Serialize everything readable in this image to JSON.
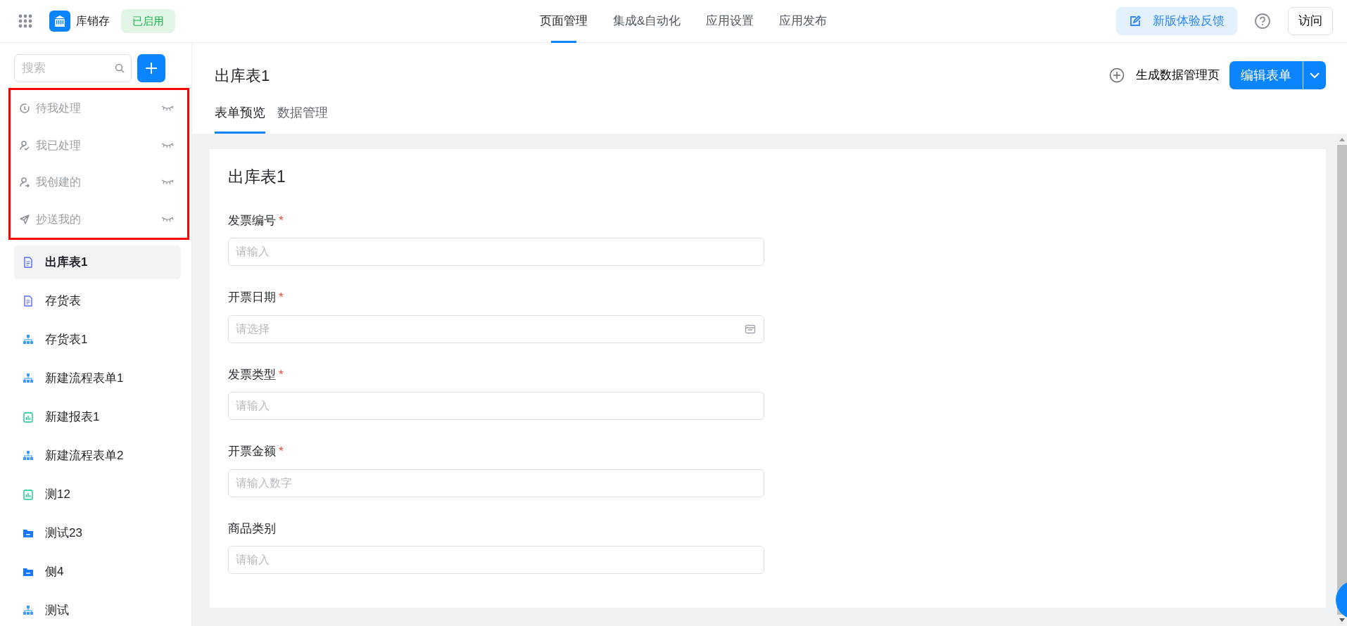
{
  "app_bar": {
    "app_name": "库销存",
    "status_badge": "已启用",
    "feedback_button": "新版体验反馈",
    "visit_button": "访问",
    "nav_tabs": [
      {
        "label": "页面管理",
        "selected": true
      },
      {
        "label": "集成&自动化",
        "selected": false
      },
      {
        "label": "应用设置",
        "selected": false
      },
      {
        "label": "应用发布",
        "selected": false
      }
    ]
  },
  "sidebar": {
    "search": {
      "placeholder": "搜索"
    },
    "system_views": {
      "highlighted": true,
      "items": [
        {
          "label": "待我处理",
          "kind": "pending",
          "hidden": true
        },
        {
          "label": "我已处理",
          "kind": "done",
          "hidden": true
        },
        {
          "label": "我创建的",
          "kind": "created",
          "hidden": true
        },
        {
          "label": "抄送我的",
          "kind": "cc",
          "hidden": true
        }
      ]
    },
    "pages": [
      {
        "label": "出库表1",
        "kind": "form",
        "selected": true
      },
      {
        "label": "存货表",
        "kind": "form",
        "selected": false
      },
      {
        "label": "存货表1",
        "kind": "flow",
        "selected": false
      },
      {
        "label": "新建流程表单1",
        "kind": "flow",
        "selected": false
      },
      {
        "label": "新建报表1",
        "kind": "report",
        "selected": false
      },
      {
        "label": "新建流程表单2",
        "kind": "flow",
        "selected": false
      },
      {
        "label": "测12",
        "kind": "report",
        "selected": false
      },
      {
        "label": "测试23",
        "kind": "folder",
        "selected": false
      },
      {
        "label": "侧4",
        "kind": "folder",
        "selected": false
      },
      {
        "label": "测试",
        "kind": "flow",
        "selected": false
      }
    ]
  },
  "page": {
    "title": "出库表1",
    "generate_link": "生成数据管理页",
    "edit_button": "编辑表单",
    "tabs": [
      {
        "label": "表单预览",
        "selected": true
      },
      {
        "label": "数据管理",
        "selected": false
      }
    ],
    "form": {
      "title": "出库表1",
      "required_mark": "*",
      "fields": [
        {
          "label": "发票编号",
          "required": true,
          "kind": "text",
          "placeholder": "请输入"
        },
        {
          "label": "开票日期",
          "required": true,
          "kind": "date",
          "placeholder": "请选择"
        },
        {
          "label": "发票类型",
          "required": true,
          "kind": "text",
          "placeholder": "请输入"
        },
        {
          "label": "开票金额",
          "required": true,
          "kind": "text",
          "placeholder": "请输入数字"
        },
        {
          "label": "商品类别",
          "required": false,
          "kind": "text",
          "placeholder": "请输入"
        }
      ]
    }
  }
}
